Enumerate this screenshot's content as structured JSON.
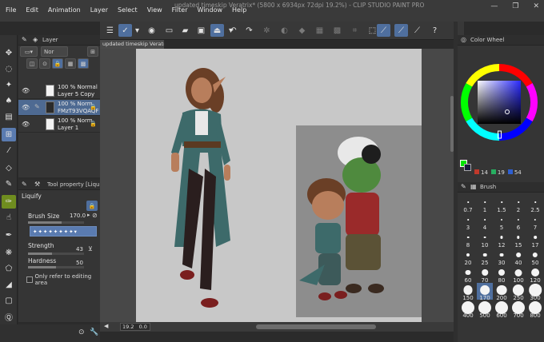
{
  "window": {
    "title": "updated timeskip Veratrix* (5800 x 6934px 72dpi 19.2%) - CLIP STUDIO PAINT PRO",
    "controls": [
      "—",
      "❐",
      "✕"
    ]
  },
  "menu": [
    "File",
    "Edit",
    "Animation",
    "Layer",
    "Select",
    "View",
    "Filter",
    "Window",
    "Help"
  ],
  "layer_panel": {
    "tab_label": "Layer",
    "blend_label": "Nor",
    "layers": [
      {
        "line1": "100 % Normal",
        "line2": "Layer 5 Copy",
        "selected": false,
        "thumb": "light"
      },
      {
        "line1": "100 % Norm",
        "line2": "FMzT93VQAQF",
        "selected": true,
        "thumb": "dark"
      },
      {
        "line1": "100 % Norm",
        "line2": "Layer 1",
        "selected": false,
        "thumb": "light"
      }
    ]
  },
  "tool_property": {
    "tab_label": "Tool property [Liqu",
    "tool_name": "Liquify",
    "brush_size_label": "Brush Size",
    "brush_size_value": "170.0",
    "strength_label": "Strength",
    "strength_value": "43",
    "strength_fraction": 0.43,
    "hardness_label": "Hardness",
    "hardness_value": "50",
    "hardness_fraction": 0.5,
    "only_refer_label": "Only refer to editing area"
  },
  "document": {
    "tab_label": "updated timeskip Veratrix*",
    "zoom": "19.2",
    "angle": "0.0"
  },
  "color_panel": {
    "tab_label": "Color Wheel",
    "main_color": "#00e400",
    "values": [
      "14",
      "19",
      "54"
    ]
  },
  "brush_size_panel": {
    "tab_label": "Brush",
    "sizes": [
      "0.7",
      "1",
      "1.5",
      "2",
      "2.5",
      "3",
      "4",
      "5",
      "6",
      "7",
      "8",
      "10",
      "12",
      "15",
      "17",
      "20",
      "25",
      "30",
      "40",
      "50",
      "60",
      "70",
      "80",
      "100",
      "120",
      "150",
      "170",
      "200",
      "250",
      "300",
      "400",
      "500",
      "600",
      "700",
      "800"
    ],
    "selected": "170"
  }
}
